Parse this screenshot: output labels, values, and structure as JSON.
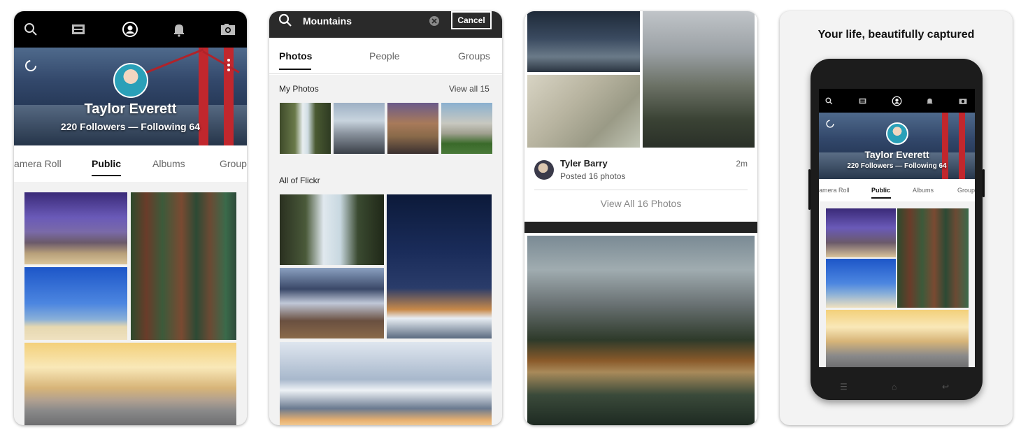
{
  "profile_screen": {
    "user_name": "Taylor Everett",
    "stats": "220 Followers — Following 64",
    "tabs": [
      "amera Roll",
      "Public",
      "Albums",
      "Group"
    ],
    "active_tab": "Public",
    "top_icons": [
      "search-icon",
      "feed-icon",
      "profile-icon",
      "notifications-icon",
      "camera-icon"
    ]
  },
  "search_screen": {
    "query": "Mountains",
    "cancel_label": "Cancel",
    "tabs": [
      "Photos",
      "People",
      "Groups"
    ],
    "active_tab": "Photos",
    "my_photos_label": "My Photos",
    "view_all_label": "View all 15",
    "all_flickr_label": "All of Flickr"
  },
  "feed_screen": {
    "poster_name": "Tyler Barry",
    "poster_action": "Posted 16 photos",
    "time": "2m",
    "view_all_label": "View All 16 Photos"
  },
  "promo_screen": {
    "title": "Your life, beautifully captured",
    "phone_user_name": "Taylor Everett",
    "phone_stats": "220 Followers — Following 64",
    "phone_tabs": [
      "amera Roll",
      "Public",
      "Albums",
      "Group"
    ]
  }
}
